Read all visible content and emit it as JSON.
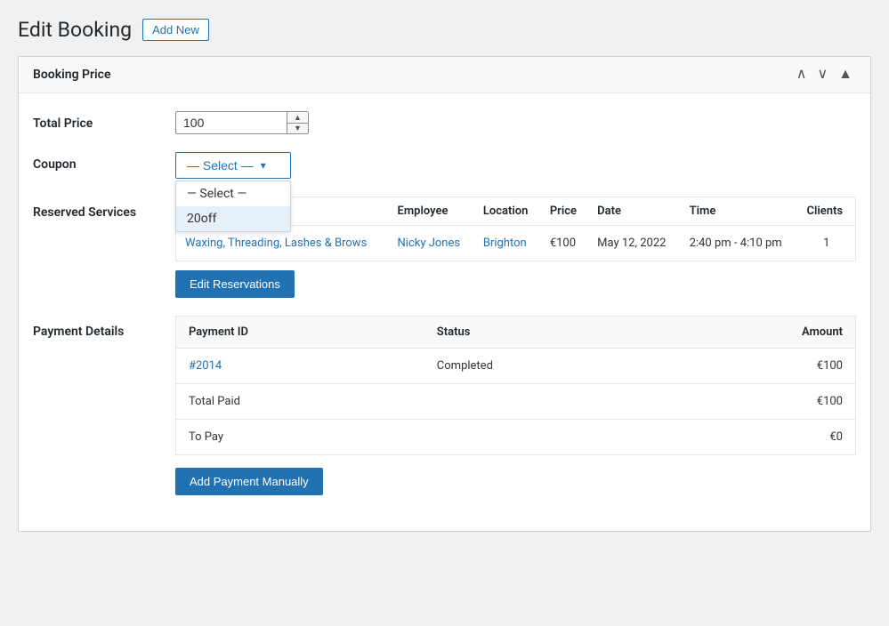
{
  "page": {
    "title": "Edit Booking",
    "add_new_label": "Add New"
  },
  "panel": {
    "title": "Booking Price",
    "controls": {
      "up": "▲",
      "down": "▼",
      "collapse": "▲"
    }
  },
  "form": {
    "total_price_label": "Total Price",
    "total_price_value": "100",
    "coupon_label": "Coupon",
    "coupon_select_default": "— Select —",
    "coupon_options": [
      "— Select —",
      "20off"
    ],
    "reserved_services_label": "Reserved Services",
    "edit_reservations_label": "Edit Reservations"
  },
  "services_table": {
    "headers": [
      "",
      "Employee",
      "Location",
      "Price",
      "Date",
      "Time",
      "Clients"
    ],
    "rows": [
      {
        "service": "Waxing, Threading, Lashes & Brows",
        "employee": "Nicky Jones",
        "location": "Brighton",
        "price": "€100",
        "date": "May 12, 2022",
        "time": "2:40 pm - 4:10 pm",
        "clients": "1"
      }
    ]
  },
  "payment_details": {
    "label": "Payment Details",
    "table_headers": [
      "Payment ID",
      "Status",
      "Amount"
    ],
    "rows": [
      {
        "id": "#2014",
        "status": "Completed",
        "amount": "€100"
      }
    ],
    "total_paid_label": "Total Paid",
    "total_paid_value": "€100",
    "to_pay_label": "To Pay",
    "to_pay_value": "€0",
    "add_payment_label": "Add Payment Manually"
  },
  "icons": {
    "chevron_down": "▾",
    "spinner_up": "▲",
    "spinner_down": "▼",
    "panel_up": "∧",
    "panel_down": "∨",
    "panel_collapse": "▲"
  }
}
